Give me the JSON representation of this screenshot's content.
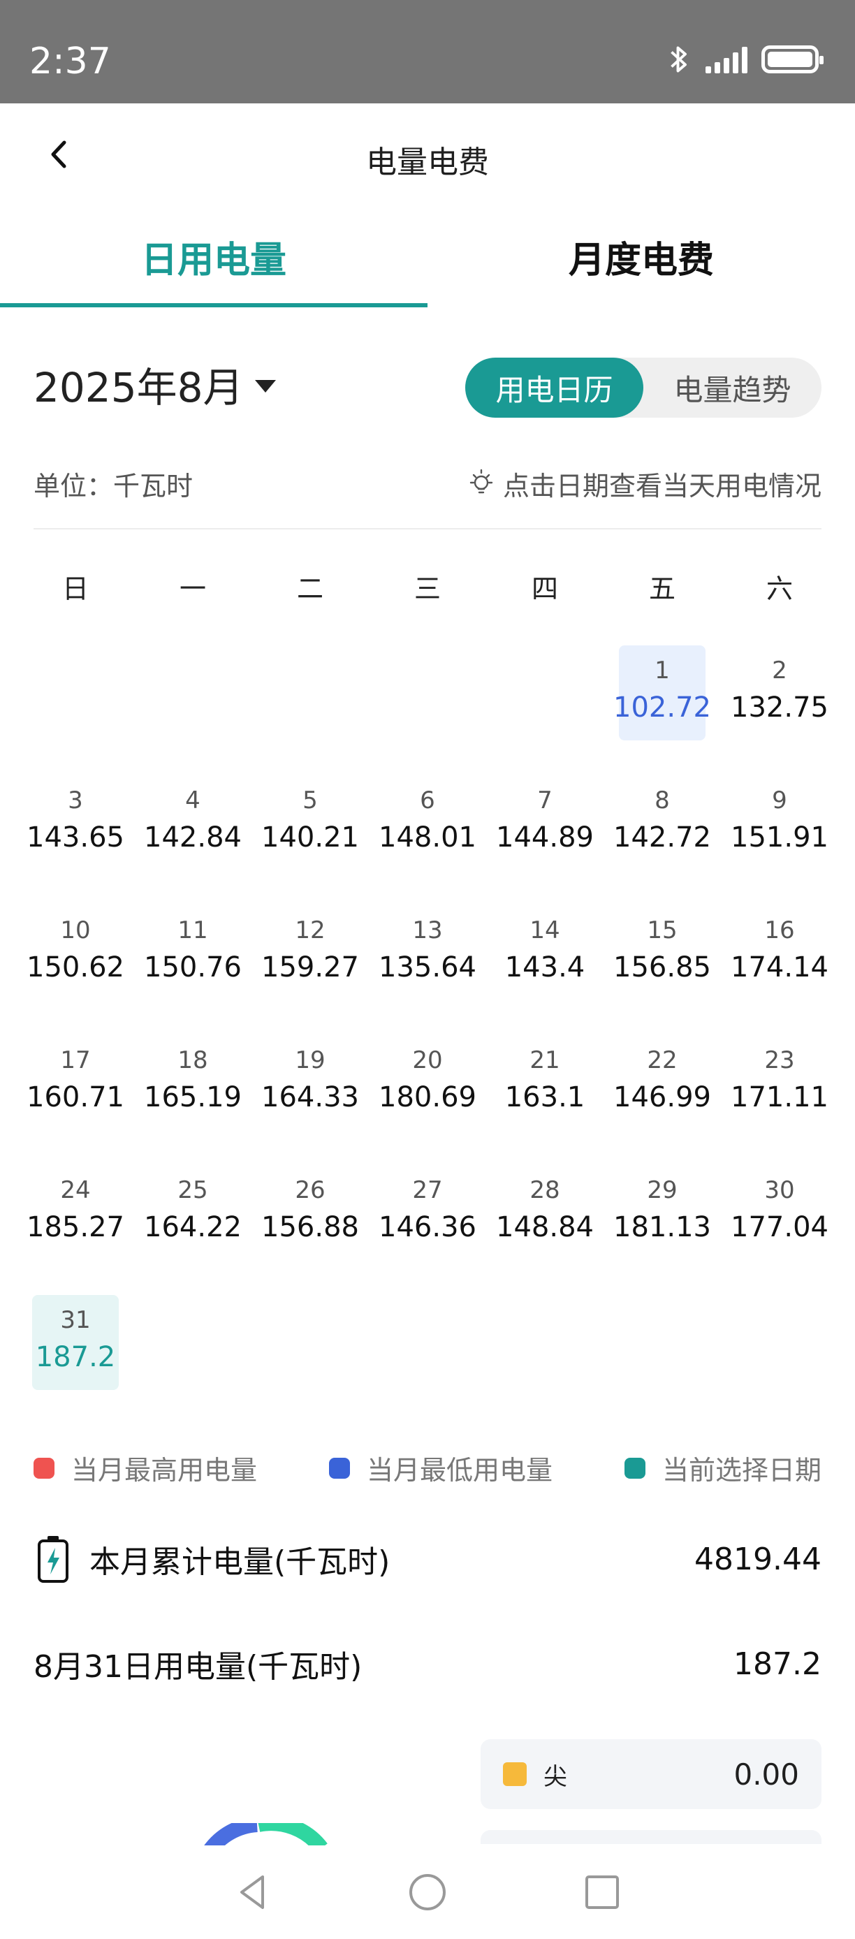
{
  "status": {
    "time": "2:37"
  },
  "header": {
    "title": "电量电费"
  },
  "tabs": [
    {
      "label": "日用电量"
    },
    {
      "label": "月度电费"
    }
  ],
  "month": {
    "label": "2025年8月"
  },
  "view_toggle": {
    "calendar": "用电日历",
    "trend": "电量趋势"
  },
  "unit_label": "单位：千瓦时",
  "hint": "点击日期查看当天用电情况",
  "weekdays": [
    "日",
    "一",
    "二",
    "三",
    "四",
    "五",
    "六"
  ],
  "calendar": {
    "first_weekday_index": 5,
    "days": [
      {
        "day": "1",
        "value": "102.72",
        "mark": "min"
      },
      {
        "day": "2",
        "value": "132.75"
      },
      {
        "day": "3",
        "value": "143.65"
      },
      {
        "day": "4",
        "value": "142.84"
      },
      {
        "day": "5",
        "value": "140.21"
      },
      {
        "day": "6",
        "value": "148.01"
      },
      {
        "day": "7",
        "value": "144.89"
      },
      {
        "day": "8",
        "value": "142.72"
      },
      {
        "day": "9",
        "value": "151.91"
      },
      {
        "day": "10",
        "value": "150.62"
      },
      {
        "day": "11",
        "value": "150.76"
      },
      {
        "day": "12",
        "value": "159.27"
      },
      {
        "day": "13",
        "value": "135.64"
      },
      {
        "day": "14",
        "value": "143.4"
      },
      {
        "day": "15",
        "value": "156.85"
      },
      {
        "day": "16",
        "value": "174.14"
      },
      {
        "day": "17",
        "value": "160.71"
      },
      {
        "day": "18",
        "value": "165.19"
      },
      {
        "day": "19",
        "value": "164.33"
      },
      {
        "day": "20",
        "value": "180.69"
      },
      {
        "day": "21",
        "value": "163.1"
      },
      {
        "day": "22",
        "value": "146.99"
      },
      {
        "day": "23",
        "value": "171.11"
      },
      {
        "day": "24",
        "value": "185.27"
      },
      {
        "day": "25",
        "value": "164.22"
      },
      {
        "day": "26",
        "value": "156.88"
      },
      {
        "day": "27",
        "value": "146.36"
      },
      {
        "day": "28",
        "value": "148.84"
      },
      {
        "day": "29",
        "value": "181.13"
      },
      {
        "day": "30",
        "value": "177.04"
      },
      {
        "day": "31",
        "value": "187.2",
        "mark": "sel"
      }
    ]
  },
  "legend": [
    {
      "label": "当月最高用电量",
      "color": "#ef5350"
    },
    {
      "label": "当月最低用电量",
      "color": "#3a63d8"
    },
    {
      "label": "当前选择日期",
      "color": "#1a9a94"
    }
  ],
  "summary": {
    "month_total_label": "本月累计电量(千瓦时)",
    "month_total_value": "4819.44",
    "day_label": "8月31日用电量(千瓦时)",
    "day_value": "187.2"
  },
  "tariff": {
    "label": "尖",
    "value": "0.00",
    "color": "#f6b93b"
  }
}
